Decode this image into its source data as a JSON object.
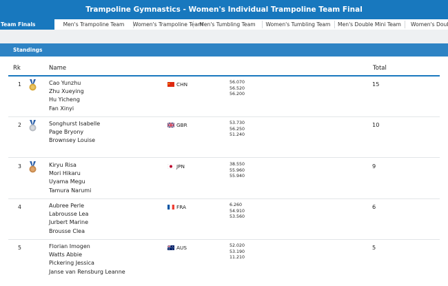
{
  "header": {
    "title": "Trampoline Gymnastics - Women's Individual Trampoline Team Final"
  },
  "tabs": [
    {
      "label": "Team Finals",
      "active": true
    },
    {
      "label": "Men's Trampoline Team",
      "active": false
    },
    {
      "label": "Women's Trampoline Team",
      "active": false
    },
    {
      "label": "Men's Tumbling Team",
      "active": false
    },
    {
      "label": "Women's Tumbling Team",
      "active": false
    },
    {
      "label": "Men's Double Mini Team",
      "active": false
    },
    {
      "label": "Women's Double M",
      "active": false
    }
  ],
  "standings": {
    "title": "Standings",
    "columns": {
      "rank": "Rk",
      "name": "Name",
      "total": "Total"
    },
    "rows": [
      {
        "rank": "1",
        "medal": "gold",
        "athletes": [
          "Cao Yunzhu",
          "Zhu Xueying",
          "Hu Yicheng",
          "Fan Xinyi"
        ],
        "flag": "china-flag",
        "noc": "CHN",
        "scores": [
          "56.070",
          "56.520",
          "56.200"
        ],
        "total": "15"
      },
      {
        "rank": "2",
        "medal": "silver",
        "athletes": [
          "Songhurst Isabelle",
          "Page Bryony",
          "Brownsey Louise"
        ],
        "flag": "uk-flag",
        "noc": "GBR",
        "scores": [
          "53.730",
          "56.250",
          "51.240"
        ],
        "total": "10"
      },
      {
        "rank": "3",
        "medal": "bronze",
        "athletes": [
          "Kiryu Risa",
          "Mori Hikaru",
          "Uyama Megu",
          "Tamura Narumi"
        ],
        "flag": "japan-flag",
        "noc": "JPN",
        "scores": [
          "38.550",
          "55.960",
          "55.940"
        ],
        "total": "9"
      },
      {
        "rank": "4",
        "medal": "",
        "athletes": [
          "Aubree Perle",
          "Labrousse Lea",
          "Jurbert Marine",
          "Brousse Clea"
        ],
        "flag": "france-flag",
        "noc": "FRA",
        "scores": [
          "6.260",
          "54.910",
          "53.560"
        ],
        "total": "6"
      },
      {
        "rank": "5",
        "medal": "",
        "athletes": [
          "Florian Imogen",
          "Watts Abbie",
          "Pickering Jessica",
          "Janse van Rensburg Leanne"
        ],
        "flag": "australia-flag",
        "noc": "AUS",
        "scores": [
          "52.020",
          "53.190",
          "11.210"
        ],
        "total": "5"
      }
    ]
  },
  "colors": {
    "primary": "#1878be",
    "standings_bar": "#2e83c4",
    "gold": "#d8a93a",
    "silver": "#b8bcc2",
    "bronze": "#c88a4e"
  }
}
